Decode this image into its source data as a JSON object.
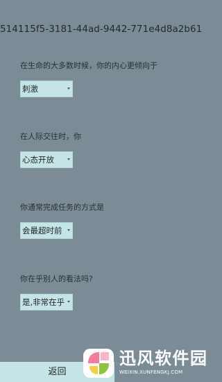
{
  "session_id": "514115f5-3181-44ad-9442-771e4d8a2b61",
  "questions": [
    {
      "text": "在生命的大多数时候，你的内心更倾向于",
      "selected": "刺激"
    },
    {
      "text": "在人际交往时，你",
      "selected": "心态开放"
    },
    {
      "text": "你通常完成任务的方式是",
      "selected": "会最超时前"
    },
    {
      "text": "你在乎别人的看法吗?",
      "selected": "是,非常在乎"
    }
  ],
  "back_label": "返回",
  "watermark": {
    "title": "迅风软件园",
    "subtitle": "WEIXIN.XUNFENGKJ.COM"
  },
  "colors": {
    "background": "#7b8c97",
    "control": "#c4e4e6",
    "logo_pink": "#f47aa0",
    "logo_green": "#8cc63f",
    "logo_yellow": "#f4d03f"
  }
}
